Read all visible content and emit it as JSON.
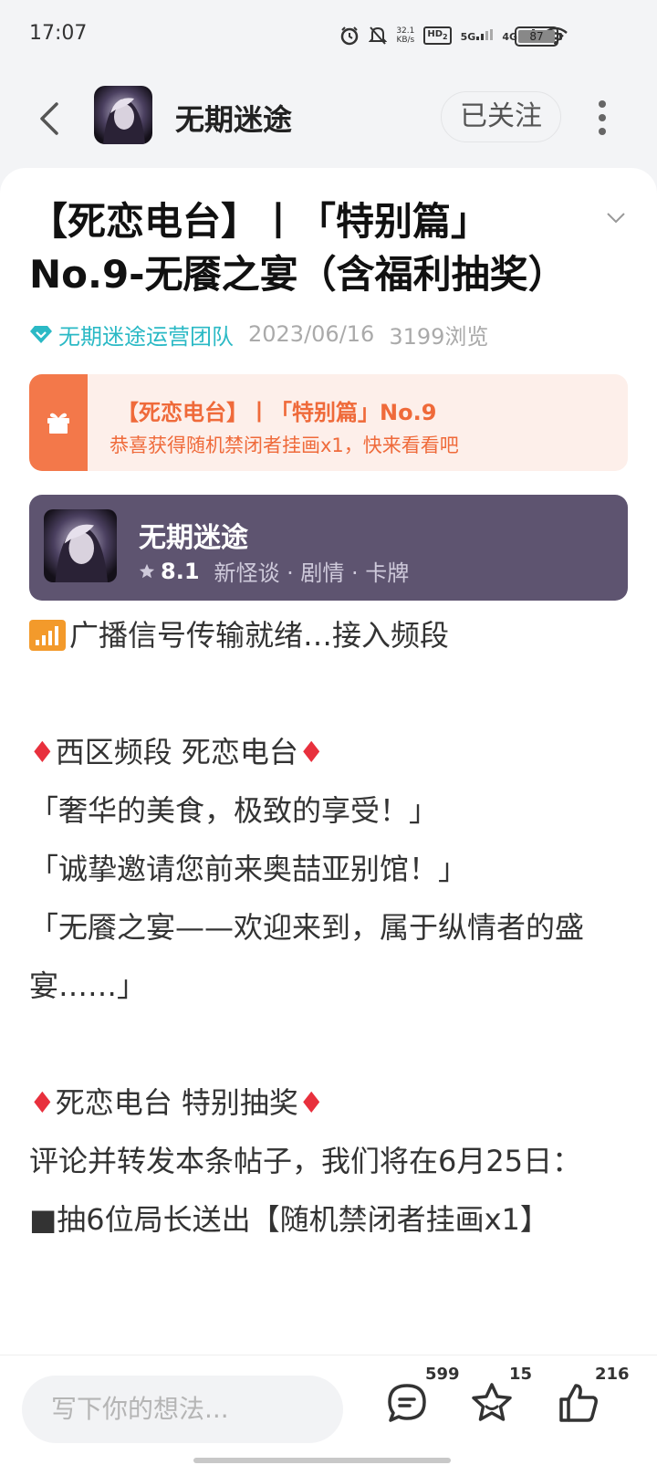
{
  "status": {
    "time": "17:07",
    "speed_value": "32.1",
    "speed_unit": "KB/s",
    "hd": "HD",
    "hd_sub": "2",
    "net1": "5G",
    "net2": "4G",
    "battery": "87"
  },
  "header": {
    "title": "无期迷途",
    "follow_label": "已关注"
  },
  "post": {
    "title_line1": "【死恋电台】丨「特别篇」",
    "title_line2": "No.9-无餍之宴（含福利抽奖）",
    "author": "无期迷途运营团队",
    "date": "2023/06/16",
    "views": "3199浏览"
  },
  "banner": {
    "title": "【死恋电台】丨「特别篇」No.9",
    "subtitle": "恭喜获得随机禁闭者挂画x1，快来看看吧"
  },
  "game": {
    "name": "无期迷途",
    "score": "8.1",
    "tags": "新怪谈 · 剧情 · 卡牌"
  },
  "content": {
    "line1": "广播信号传输就绪…接入频段",
    "line2": "西区频段 死恋电台",
    "line3": "「奢华的美食，极致的享受！」",
    "line4": "「诚挚邀请您前来奥喆亚别馆！」",
    "line5": "「无餍之宴——欢迎来到，属于纵情者的盛宴……」",
    "line6": "死恋电台 特别抽奖",
    "line7": "评论并转发本条帖子，我们将在6月25日：",
    "line8": "■抽6位局长送出【随机禁闭者挂画x1】"
  },
  "bottom": {
    "placeholder": "写下你的想法...",
    "comments": "599",
    "favorites": "15",
    "likes": "216"
  }
}
